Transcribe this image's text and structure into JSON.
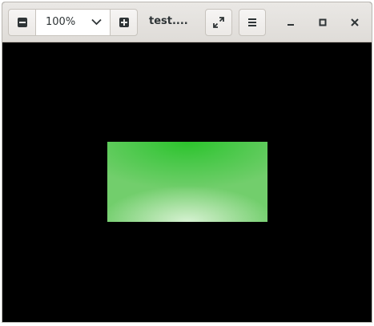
{
  "window": {
    "title": "test....",
    "zoom_value": "100%"
  },
  "icons": {
    "zoom_out": "minus-square-icon",
    "zoom_in": "plus-square-icon",
    "zoom_dropdown": "chevron-down-icon",
    "fullscreen": "expand-icon",
    "menu": "hamburger-menu-icon",
    "minimize": "minimize-icon",
    "maximize": "maximize-icon",
    "close": "close-icon"
  },
  "colors": {
    "headerbar": "#e5e2df",
    "canvas_background": "#000000",
    "image_green_top": "#2cc42c",
    "image_green_bottom": "#d6f2d2"
  }
}
